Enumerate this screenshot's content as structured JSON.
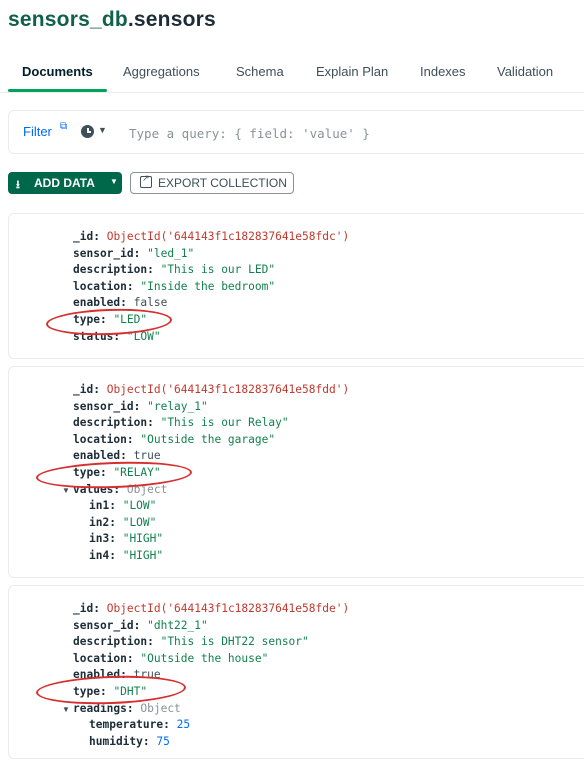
{
  "header": {
    "db": "sensors_db",
    "collection": ".sensors"
  },
  "tabs": [
    {
      "label": "Documents"
    },
    {
      "label": "Aggregations"
    },
    {
      "label": "Schema"
    },
    {
      "label": "Explain Plan"
    },
    {
      "label": "Indexes"
    },
    {
      "label": "Validation"
    }
  ],
  "query": {
    "filter_label": "Filter",
    "placeholder": "Type a query: { field: 'value' }"
  },
  "toolbar": {
    "add_data_label": "ADD DATA",
    "export_label": "EXPORT COLLECTION"
  },
  "documents": [
    {
      "id": "ObjectId('644143f1c182837641e58fdc')",
      "sensor_id": "\"led_1\"",
      "description": "\"This is our LED\"",
      "location": "\"Inside the bedroom\"",
      "enabled": "false",
      "type": "\"LED\"",
      "status": "\"LOW\""
    },
    {
      "id": "ObjectId('644143f1c182837641e58fdd')",
      "sensor_id": "\"relay_1\"",
      "description": "\"This is our Relay\"",
      "location": "\"Outside the garage\"",
      "enabled": "true",
      "type": "\"RELAY\"",
      "values_type": "Object",
      "values": [
        {
          "key": "in1:",
          "val": "\"LOW\""
        },
        {
          "key": "in2:",
          "val": "\"LOW\""
        },
        {
          "key": "in3:",
          "val": "\"HIGH\""
        },
        {
          "key": "in4:",
          "val": "\"HIGH\""
        }
      ]
    },
    {
      "id": "ObjectId('644143f1c182837641e58fde')",
      "sensor_id": "\"dht22_1\"",
      "description": "\"This is DHT22 sensor\"",
      "location": "\"Outside the house\"",
      "enabled": "true",
      "type": "\"DHT\"",
      "readings_type": "Object",
      "readings": [
        {
          "key": "temperature:",
          "val": "25"
        },
        {
          "key": "humidity:",
          "val": "75"
        }
      ]
    }
  ],
  "keys": {
    "id": "_id:",
    "sensor_id": "sensor_id:",
    "description": "description:",
    "location": "location:",
    "enabled": "enabled:",
    "type": "type:",
    "status": "status:",
    "values": "values:",
    "readings": "readings:"
  },
  "colors": {
    "accent": "#00684a",
    "tab_active": "#00a35c",
    "annotation": "#d62f2f"
  }
}
